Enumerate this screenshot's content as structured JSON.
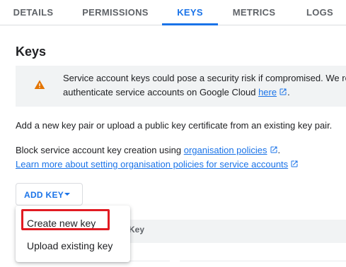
{
  "tabs": [
    {
      "label": "DETAILS",
      "active": false
    },
    {
      "label": "PERMISSIONS",
      "active": false
    },
    {
      "label": "KEYS",
      "active": true
    },
    {
      "label": "METRICS",
      "active": false
    },
    {
      "label": "LOGS",
      "active": false
    }
  ],
  "page_title": "Keys",
  "banner": {
    "icon": "warning-icon",
    "line1": "Service account keys could pose a security risk if compromised. We re",
    "line2_prefix": "authenticate service accounts on Google Cloud ",
    "line2_link": "here",
    "line2_suffix": "."
  },
  "intro_text": "Add a new key pair or upload a public key certificate from an existing key pair.",
  "policy": {
    "prefix": "Block service account key creation using ",
    "link": "organisation policies",
    "suffix": ".",
    "learn_more_link": "Learn more about setting organisation policies for service accounts"
  },
  "add_key_button": "ADD KEY",
  "table": {
    "visible_header": "Key"
  },
  "menu": {
    "items": [
      {
        "label": "Create new key",
        "highlighted": true
      },
      {
        "label": "Upload existing key",
        "highlighted": false
      }
    ]
  },
  "colors": {
    "accent": "#1a73e8",
    "warning": "#e37400",
    "highlight": "#e11b22"
  }
}
